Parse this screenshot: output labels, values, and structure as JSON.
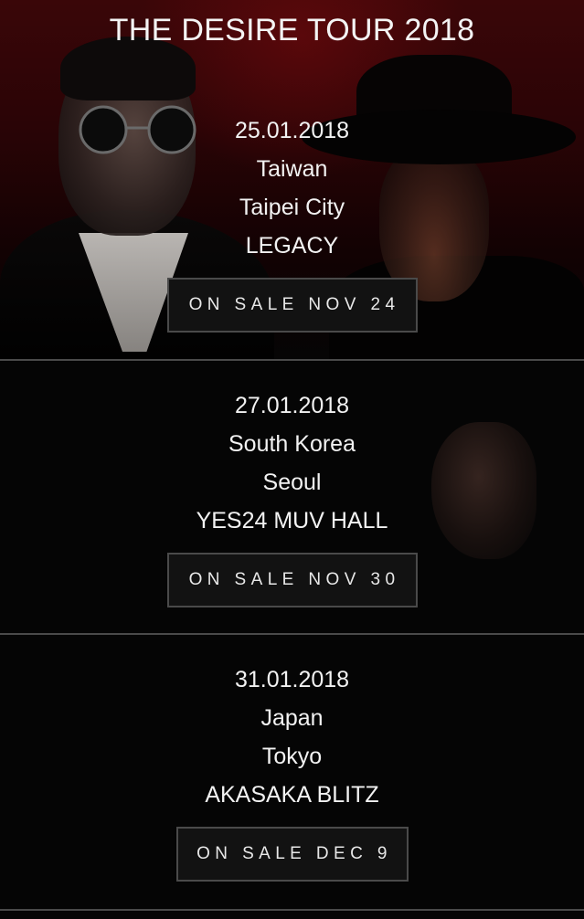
{
  "page": {
    "title": "THE DESIRE TOUR 2018"
  },
  "events": [
    {
      "date": "25.01.2018",
      "country": "Taiwan",
      "city": "Taipei City",
      "venue": "LEGACY",
      "button_label": "ON SALE NOV 24"
    },
    {
      "date": "27.01.2018",
      "country": "South Korea",
      "city": "Seoul",
      "venue": "YES24 MUV HALL",
      "button_label": "ON SALE NOV 30"
    },
    {
      "date": "31.01.2018",
      "country": "Japan",
      "city": "Tokyo",
      "venue": "AKASAKA BLITZ",
      "button_label": "ON SALE DEC 9"
    }
  ],
  "colors": {
    "background": "#050505",
    "hero_red": "#3a0608",
    "text": "#f2f2f2",
    "button_border": "#4a4a4a",
    "divider": "#4a4a4a"
  }
}
